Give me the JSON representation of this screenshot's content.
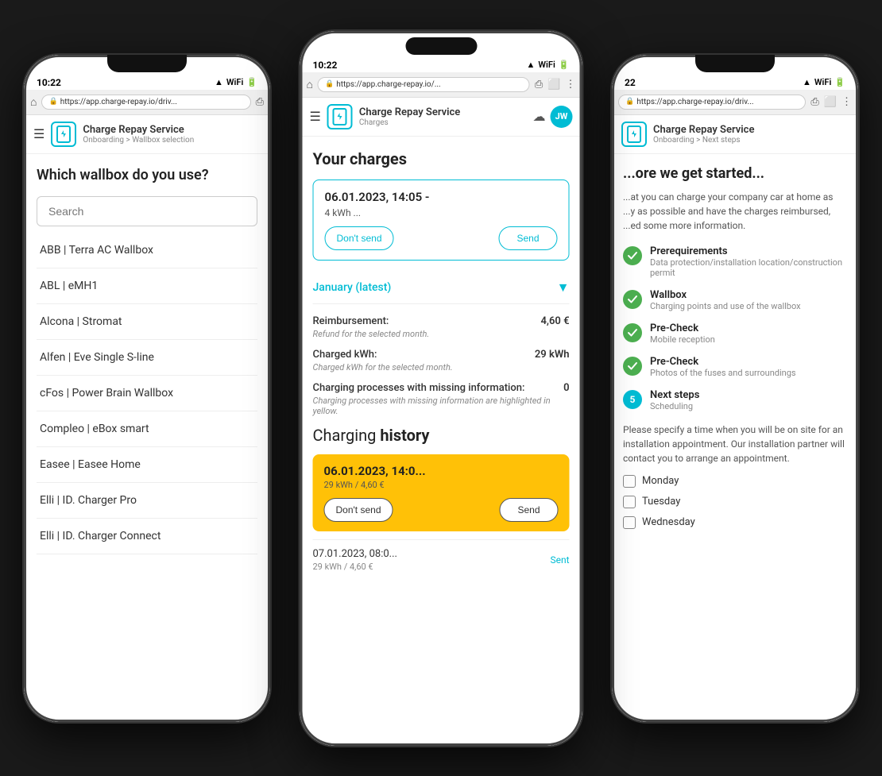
{
  "phones": {
    "left": {
      "status_time": "10:22",
      "url": "https://app.charge-repay.io/driv...",
      "app_name": "Charge Repay Service",
      "breadcrumb": "Onboarding > Wallbox selection",
      "page_title": "Which wallbox do you use?",
      "search_placeholder": "Search",
      "wallbox_items": [
        "ABB | Terra AC Wallbox",
        "ABL | eMH1",
        "Alcona | Stromat",
        "Alfen | Eve Single S-line",
        "cFos | Power Brain Wallbox",
        "Compleo | eBox smart",
        "Easee | Easee Home",
        "Elli | ID. Charger Pro",
        "Elli | ID. Charger Connect"
      ]
    },
    "center": {
      "status_time": "10:22",
      "url": "https://app.charge-repay.io/...",
      "app_name": "Charge Repay Service",
      "page_subtitle": "Charges",
      "avatar_initials": "JW",
      "page_title": "Your charges",
      "latest_charge_date": "06.01.2023, 14:05 -",
      "latest_charge_kwh": "4 kWh ...",
      "dont_send_label": "Don't send",
      "send_label": "Send",
      "month_label": "January (latest)",
      "reimbursement_label": "Reimbursement:",
      "reimbursement_value": "4,60 €",
      "reimbursement_sub": "Refund for the selected month.",
      "charged_kwh_label": "Charged kWh:",
      "charged_kwh_value": "29 kWh",
      "charged_kwh_sub": "Charged kWh for the selected month.",
      "missing_label": "Charging processes with missing information:",
      "missing_value": "0",
      "missing_sub": "Charging processes with missing information are highlighted in yellow.",
      "history_title_prefix": "Charging ",
      "history_title_bold": "history",
      "history_entry1_date": "06.01.2023, 14:0...",
      "history_entry1_detail": "29 kWh / 4,60 €",
      "history_entry2_date": "07.01.2023, 08:0...",
      "history_entry2_detail": "29 kWh / 4,60 €",
      "history_entry2_status": "Sent"
    },
    "right": {
      "status_time": "22",
      "url": "https://app.charge-repay.io/driv...",
      "app_name": "Charge Repay Service",
      "breadcrumb": "Onboarding > Next steps",
      "page_title": "...ore we get started...",
      "intro_text": "...at you can charge your company car at home as ...y as possible and have the charges reimbursed, ...ed some more information.",
      "steps": [
        {
          "title": "Prerequirements",
          "sub": "Data protection/installation location/construction permit",
          "done": true,
          "number": null
        },
        {
          "title": "Wallbox",
          "sub": "Charging points and use of the wallbox",
          "done": true,
          "number": null
        },
        {
          "title": "Pre-Check",
          "sub": "Mobile reception",
          "done": true,
          "number": null
        },
        {
          "title": "Pre-Check",
          "sub": "Photos of the fuses and surroundings",
          "done": true,
          "number": null
        },
        {
          "title": "Next steps",
          "sub": "Scheduling",
          "done": false,
          "number": "5"
        }
      ],
      "scheduling_text": "Please specify a time when you will be on site for an installation appointment. Our installation partner will contact you to arrange an appointment.",
      "days": [
        "Monday",
        "Tuesday",
        "Wednesday"
      ]
    }
  }
}
